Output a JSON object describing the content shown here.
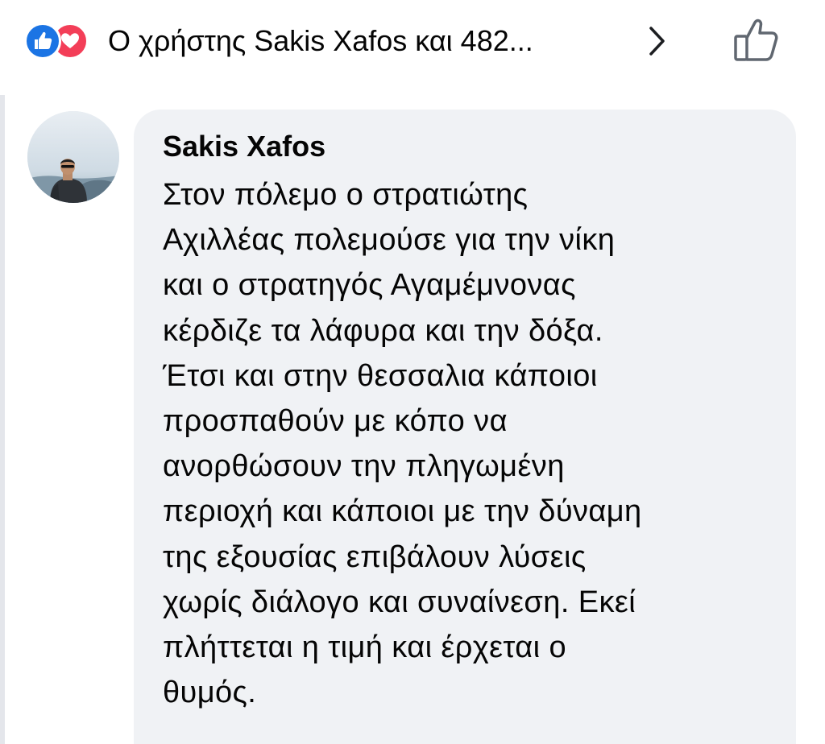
{
  "reactions": {
    "icons": [
      "like-icon",
      "love-icon"
    ],
    "summary": "Ο χρήστης Sakis Xafos και 482...",
    "colors": {
      "like": "#1b74e4",
      "love": "#f33e58"
    },
    "chevron_icon": "chevron-right-icon",
    "like_button_icon": "thumbs-up-outline-icon"
  },
  "comment": {
    "author": "Sakis Xafos",
    "avatar": "avatar-photo",
    "lines": [
      "Στον πόλεμο ο στρατιώτης",
      "Αχιλλέας πολεμούσε για την νίκη",
      "και ο στρατηγός Αγαμέμνονας",
      "κέρδιζε τα λάφυρα και την δόξα.",
      "Έτσι και στην θεσσαλια κάποιοι",
      "προσπαθούν με κόπο να",
      "ανορθώσουν την πληγωμένη",
      "περιοχή και κάποιοι με την δύναμη",
      "της εξουσίας επιβάλουν λύσεις",
      "χωρίς διάλογο και συναίνεση. Εκεί",
      "πλήττεται η τιμή και έρχεται ο",
      "θυμός."
    ],
    "bubble_color": "#f0f2f5"
  }
}
